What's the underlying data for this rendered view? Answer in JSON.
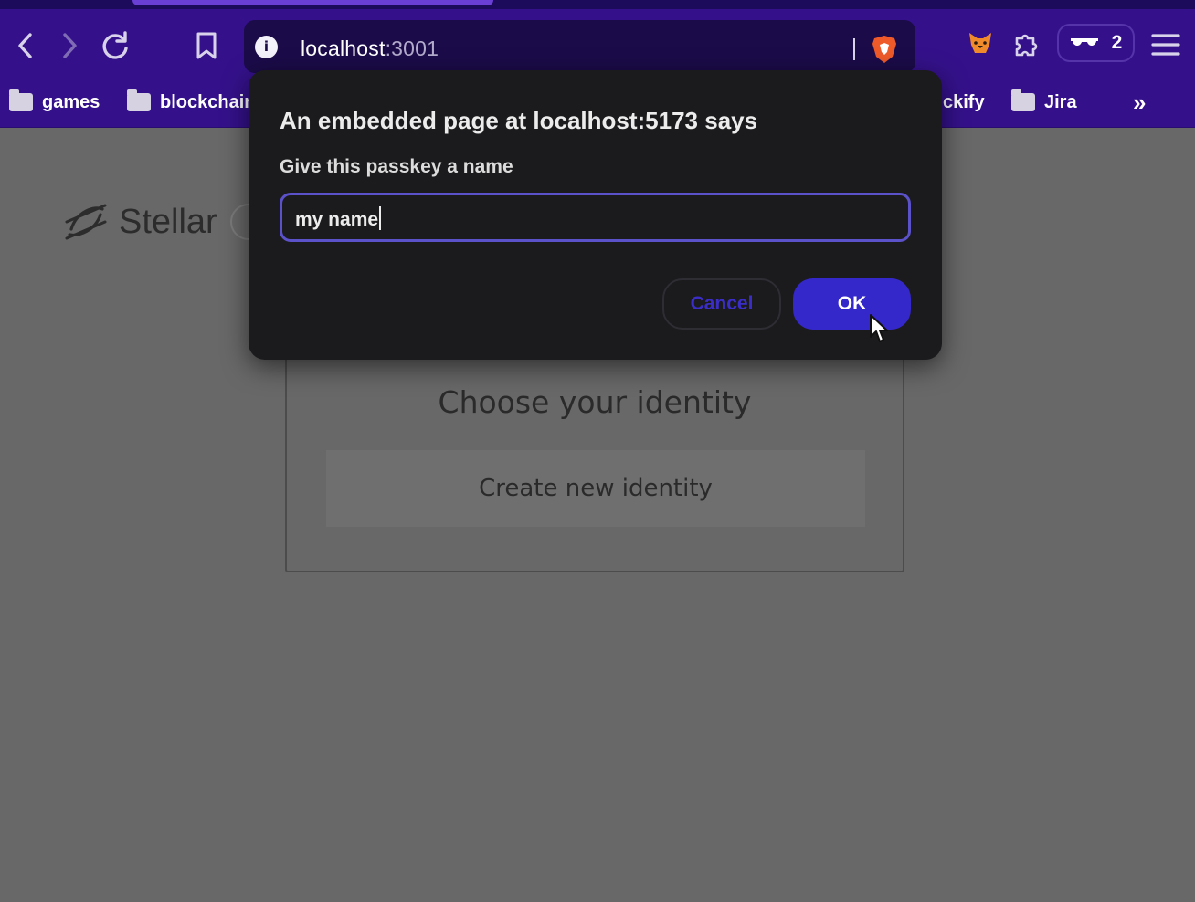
{
  "browser": {
    "url_host": "localhost",
    "url_port": ":3001",
    "profile_count": "2",
    "bookmarks": [
      {
        "label": "games"
      },
      {
        "label": "blockchair"
      },
      {
        "label": "ckify"
      },
      {
        "label": "Jira"
      }
    ],
    "overflow_label": "»"
  },
  "page": {
    "logo_text": "Stellar",
    "card": {
      "heading": "Choose your identity",
      "create_button": "Create new identity"
    }
  },
  "dialog": {
    "title": "An embedded page at localhost:5173 says",
    "message": "Give this passkey a name",
    "input_value": "my name",
    "cancel_label": "Cancel",
    "ok_label": "OK"
  },
  "colors": {
    "chrome": "#34118a",
    "accent": "#3528cb",
    "dialog_bg": "#1b1b1d"
  }
}
